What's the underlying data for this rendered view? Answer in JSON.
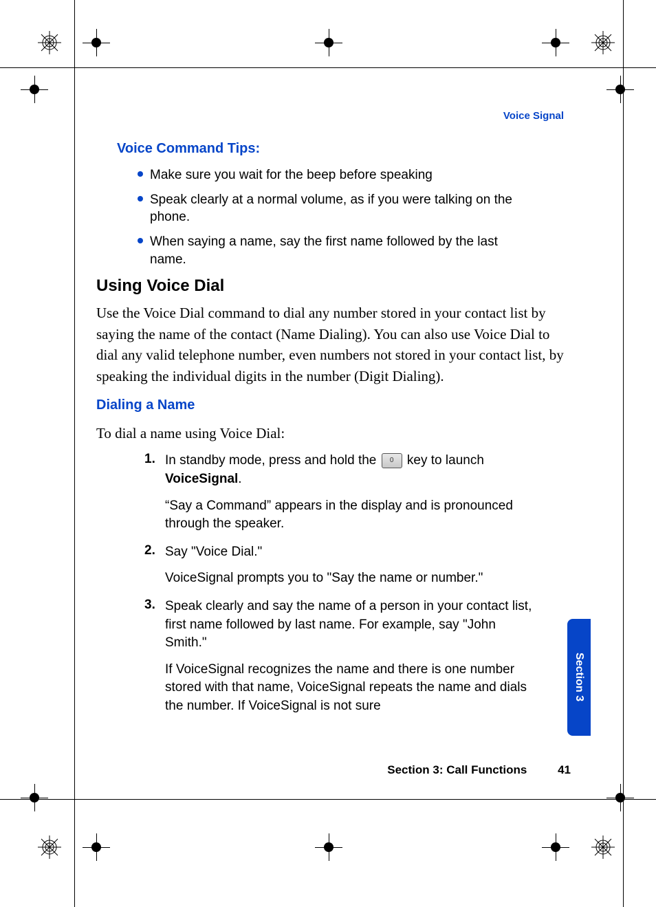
{
  "header": {
    "right_label": "Voice Signal"
  },
  "tips": {
    "heading": "Voice Command Tips:",
    "items": [
      "Make sure you wait for the beep before speaking",
      "Speak clearly at a normal volume, as if you were talking on the phone.",
      "When saying a name, say the first name followed by the last name."
    ]
  },
  "using_voice_dial": {
    "heading": "Using Voice Dial",
    "body": "Use the Voice Dial command to dial any number stored in your contact list by saying the name of the contact (Name Dialing). You can also use Voice Dial to dial any valid telephone number, even numbers not stored in your contact list, by speaking the individual digits in the number (Digit Dialing)."
  },
  "dialing_name": {
    "heading": "Dialing a Name",
    "intro": "To dial a name using Voice Dial:",
    "steps": [
      {
        "num": "1.",
        "main_pre": "In standby mode, press and hold the ",
        "key_label": "0",
        "main_post": " key to launch ",
        "main_bold": "VoiceSignal",
        "main_tail": ".",
        "follow": "“Say a Command” appears in the display and is pronounced through the speaker."
      },
      {
        "num": "2.",
        "main": "Say \"Voice Dial.\"",
        "follow": "VoiceSignal prompts you to \"Say the name or number.\""
      },
      {
        "num": "3.",
        "main": "Speak clearly and say the name of a person in your contact list, first name followed by last name. For example, say \"John Smith.\"",
        "follow": "If VoiceSignal recognizes the name and there is one number stored with that name, VoiceSignal repeats the name and dials the number. If VoiceSignal is not sure"
      }
    ]
  },
  "section_tab": "Section 3",
  "footer": {
    "section": "Section 3: Call Functions",
    "page": "41"
  }
}
